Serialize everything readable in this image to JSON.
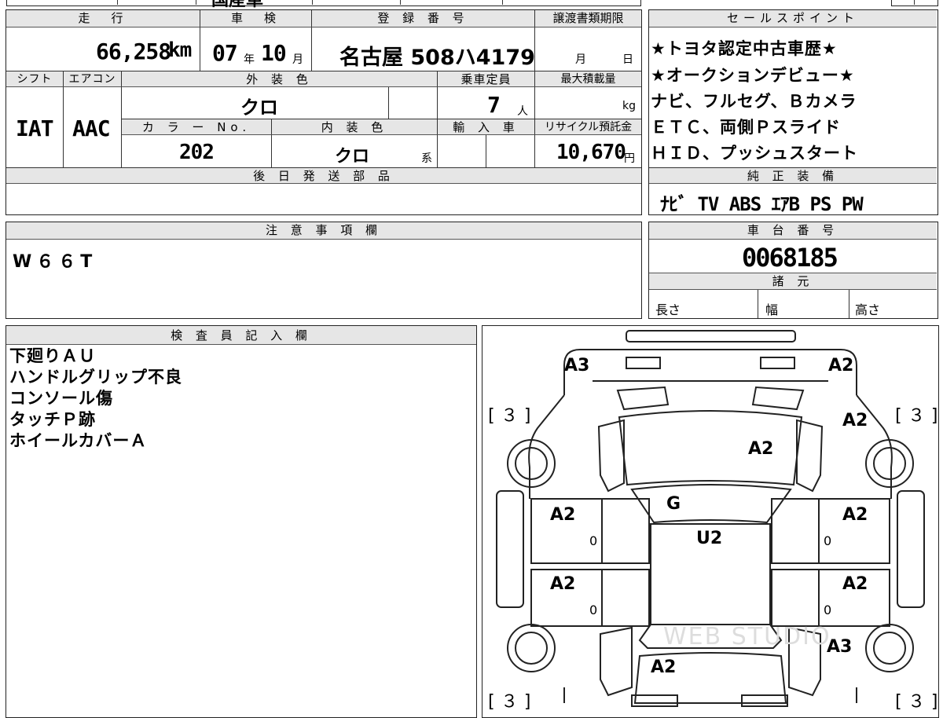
{
  "top_strip": {
    "partial_title": "国産車"
  },
  "table": {
    "mileage": {
      "label": "走　行",
      "value": "66,258",
      "unit": "km"
    },
    "inspection": {
      "label": "車　検",
      "year": "07",
      "year_unit": "年",
      "month": "10",
      "month_unit": "月"
    },
    "registration": {
      "label": "登 録 番 号",
      "value": "名古屋 508ハ4179"
    },
    "transfer_deadline": {
      "label": "譲渡書類期限",
      "month_unit": "月",
      "day_unit": "日"
    },
    "shift": {
      "label": "シフト",
      "value": "IAT"
    },
    "aircon": {
      "label": "エアコン",
      "value": "AAC"
    },
    "exterior_color": {
      "label": "外 装 色",
      "value": "クロ"
    },
    "capacity": {
      "label": "乗車定員",
      "value": "7",
      "unit": "人"
    },
    "max_load": {
      "label": "最大積載量",
      "unit": "kg"
    },
    "color_no": {
      "label": "カ ラ ー No.",
      "value": "202"
    },
    "interior_color": {
      "label": "内 装 色",
      "value": "クロ",
      "suffix": "系"
    },
    "import": {
      "label": "輸 入 車"
    },
    "recycle_fee": {
      "label": "リサイクル預託金",
      "value": "10,670",
      "unit": "円"
    },
    "later_parts": {
      "label": "後 日 発 送 部 品"
    }
  },
  "sales_points": {
    "label": "セールスポイント",
    "lines": [
      "★トヨタ認定中古車歴★",
      "★オークションデビュー★",
      "ナビ、フルセグ、Ｂカメラ",
      "ＥＴＣ、両側Ｐスライド",
      "ＨＩＤ、プッシュスタート"
    ]
  },
  "genuine_equipment": {
    "label": "純 正 装 備",
    "value": "ﾅﾋﾞ TV ABS ｴｱB PS PW"
  },
  "notes": {
    "label": "注 意 事 項 欄",
    "value": "W６６T"
  },
  "chassis": {
    "label": "車 台 番 号",
    "value": "0068185"
  },
  "specs": {
    "label": "諸 元",
    "length": "長さ",
    "width": "幅",
    "height": "高さ"
  },
  "inspector": {
    "label": "検 査 員 記 入 欄",
    "lines": [
      "下廻りＡＵ",
      "ハンドルグリップ不良",
      "コンソール傷",
      "タッチＰ跡",
      "ホイールカバーＡ"
    ]
  },
  "diagram": {
    "marks": {
      "front_left": "A3",
      "front_right": "A2",
      "hood": "A2",
      "windshield": "G",
      "roof": "U2",
      "fender_right": "A2",
      "door_fl": "A2",
      "door_fr": "A2",
      "door_rl": "A2",
      "door_rr": "A2",
      "rear_right": "A3",
      "rear": "A2",
      "zero_fl": "0",
      "zero_fr": "0",
      "zero_rl": "0",
      "zero_rr": "0"
    },
    "tire_top_left": "[３]",
    "tire_top_right": "[３]",
    "tire_bottom_left": "[３]",
    "tire_bottom_right": "[３]",
    "watermark": "WEB STUDIO"
  }
}
